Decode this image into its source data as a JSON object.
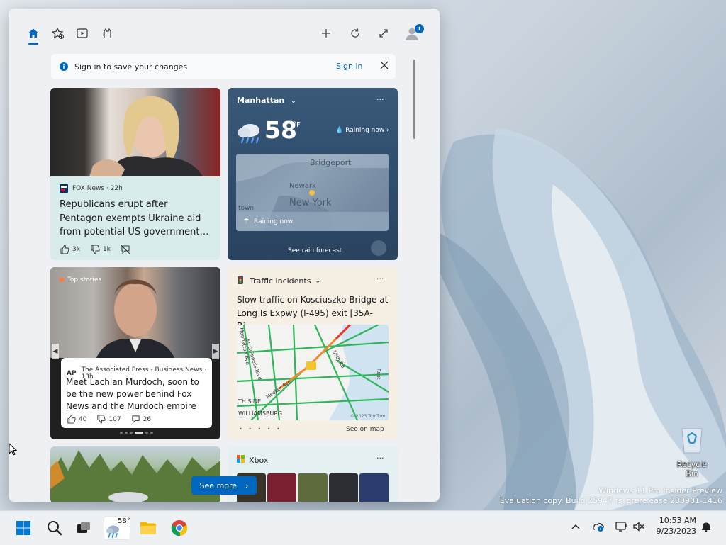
{
  "colors": {
    "accent": "#0067c0",
    "weather_bg": "#2f4d6d",
    "news_bg": "#d9ecec",
    "traffic_bg": "#f6efe4"
  },
  "toolbar": {
    "icons": [
      "home-icon",
      "star-icon",
      "video-icon",
      "pet-icon",
      "plus-icon",
      "refresh-icon",
      "expand-icon",
      "avatar-icon"
    ],
    "avatar_badge": "i"
  },
  "signin_bar": {
    "message": "Sign in to save your changes",
    "link": "Sign in"
  },
  "news_card": {
    "source": "FOX News · 22h",
    "headline": "Republicans erupt after Pentagon exempts Ukraine aid from potential US government…",
    "likes": "3k",
    "dislikes": "1k"
  },
  "weather": {
    "location": "Manhattan",
    "temperature": "58",
    "unit": "°F",
    "condition": "Raining now",
    "map_labels": [
      "Bridgeport",
      "Newark",
      "New York",
      "town"
    ],
    "map_status": "Raining now",
    "action": "See rain forecast"
  },
  "top_stories": {
    "tag": "Top stories",
    "source": "The Associated Press - Business News · 13h",
    "source_logo": "AP",
    "headline": "Meet Lachlan Murdoch, soon to be the new power behind Fox News and the Murdoch empire",
    "likes": "40",
    "dislikes": "107",
    "comments": "26"
  },
  "traffic": {
    "title": "Traffic incidents",
    "headline": "Slow traffic on Kosciuszko Bridge at Long Is Expwy (I-495) exit [35A-B]…",
    "map_labels": [
      "McGuinness Blvd",
      "Manhattan Ave",
      "56th Rd",
      "Meeker Ave",
      "TH SIDE",
      "WILLIAMSBURG",
      "© 2023 TomTom",
      "Rust"
    ],
    "pages": "• • • • •",
    "action": "See on map"
  },
  "xbox": {
    "title": "Xbox"
  },
  "see_more": "See more",
  "desktop": {
    "recycle_bin": "Recycle Bin",
    "watermark_line1": "Windows 11 Pro Insider Preview",
    "watermark_line2": "Evaluation copy. Build 25947.rs_prerelease.230901-1416"
  },
  "taskbar": {
    "weather_temp": "58°",
    "time": "10:53 AM",
    "date": "9/23/2023"
  }
}
